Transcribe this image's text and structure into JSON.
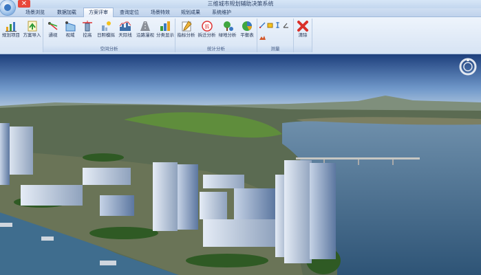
{
  "window": {
    "title": "三维城市规划辅助决策系统"
  },
  "tabs": [
    {
      "label": "场景浏览",
      "active": false
    },
    {
      "label": "数据加载",
      "active": false
    },
    {
      "label": "方案评审",
      "active": true
    },
    {
      "label": "查询定位",
      "active": false
    },
    {
      "label": "场景特效",
      "active": false
    },
    {
      "label": "规划成果",
      "active": false
    },
    {
      "label": "系统维护",
      "active": false
    }
  ],
  "groups": {
    "project": {
      "label": "",
      "buttons": [
        {
          "label": "规划项目",
          "icon": "chart-bars-icon"
        },
        {
          "label": "方案导入",
          "icon": "import-icon"
        }
      ]
    },
    "spatial": {
      "label": "空间分析",
      "buttons": [
        {
          "label": "通视",
          "icon": "sightline-icon"
        },
        {
          "label": "视域",
          "icon": "viewshed-icon"
        },
        {
          "label": "控高",
          "icon": "height-limit-icon"
        },
        {
          "label": "日照模拟",
          "icon": "sunlight-icon"
        },
        {
          "label": "天际线",
          "icon": "skyline-icon"
        },
        {
          "label": "沿路漫视",
          "icon": "road-roam-icon"
        },
        {
          "label": "分类显示",
          "icon": "classify-icon"
        }
      ]
    },
    "stats": {
      "label": "统计分析",
      "buttons": [
        {
          "label": "指标分析",
          "icon": "index-icon"
        },
        {
          "label": "拆迁分析",
          "icon": "demolition-icon"
        },
        {
          "label": "绿地分析",
          "icon": "greenland-icon"
        },
        {
          "label": "平衡表",
          "icon": "balance-icon"
        }
      ]
    },
    "measure": {
      "label": "测量"
    },
    "clear": {
      "buttons": [
        {
          "label": "清除",
          "icon": "clear-x-icon"
        }
      ]
    }
  },
  "colors": {
    "accent": "#3b78c2",
    "ribbon": "#dbe7f6",
    "clear": "#d9302a"
  }
}
